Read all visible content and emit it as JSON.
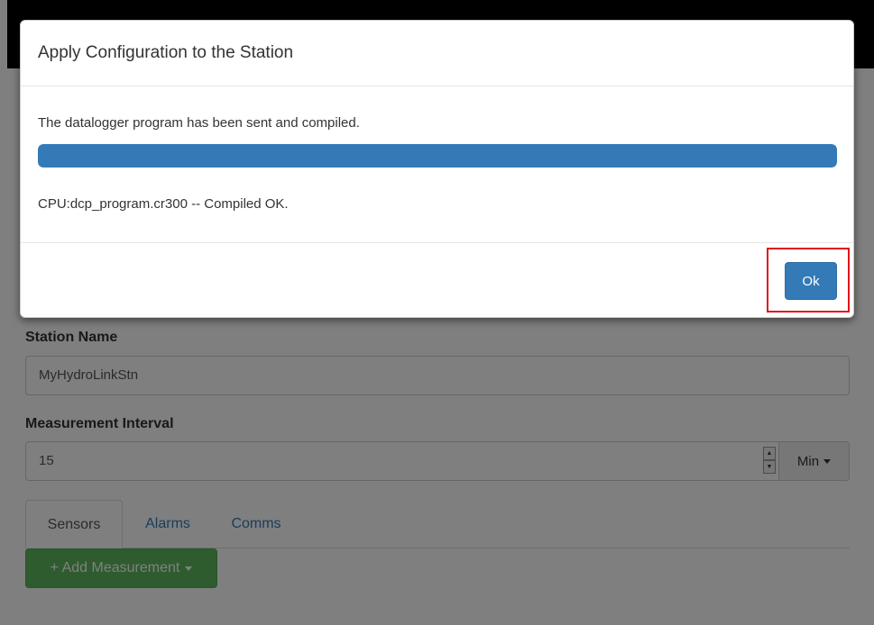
{
  "form": {
    "station_name_label": "Station Name",
    "station_name_value": "MyHydroLinkStn",
    "interval_label": "Measurement Interval",
    "interval_value": "15",
    "interval_unit": "Min",
    "tabs": [
      {
        "label": "Sensors",
        "active": true
      },
      {
        "label": "Alarms",
        "active": false
      },
      {
        "label": "Comms",
        "active": false
      }
    ],
    "add_measurement_label": "+ Add Measurement"
  },
  "modal": {
    "title": "Apply Configuration to the Station",
    "message": "The datalogger program has been sent and compiled.",
    "progress_percent": 100,
    "status": "CPU:dcp_program.cr300 -- Compiled OK.",
    "ok_label": "Ok"
  },
  "colors": {
    "primary": "#337ab7",
    "success": "#5cb85c",
    "highlight": "#e0141e"
  },
  "icons": {
    "spinner_up": "▲",
    "spinner_down": "▼"
  }
}
